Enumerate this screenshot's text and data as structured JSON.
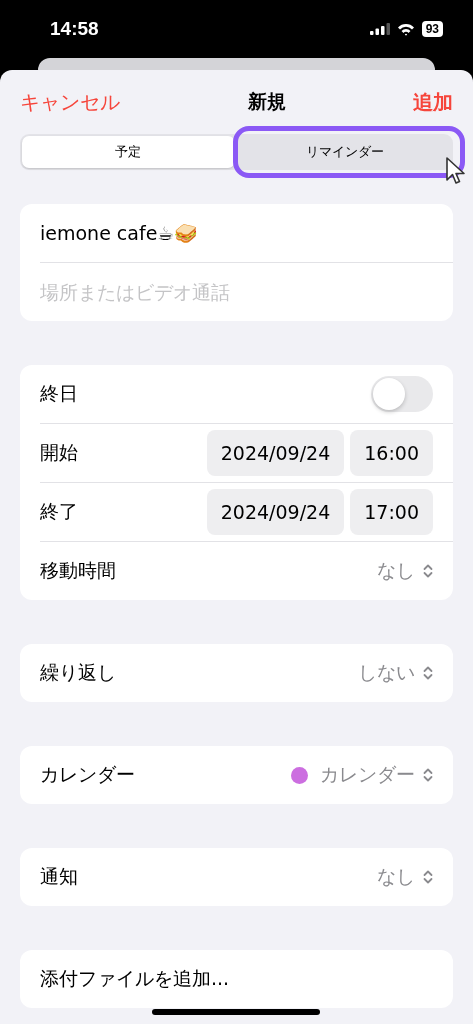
{
  "status_bar": {
    "time": "14:58",
    "battery": "93"
  },
  "nav": {
    "cancel": "キャンセル",
    "title": "新規",
    "add": "追加"
  },
  "segments": [
    {
      "label": "予定",
      "selected": true,
      "highlighted": false
    },
    {
      "label": "リマインダー",
      "selected": false,
      "highlighted": true
    }
  ],
  "event": {
    "title": "iemone cafe☕🥪",
    "location_placeholder": "場所またはビデオ通話"
  },
  "sections": [
    {
      "rows": [
        {
          "kind": "toggle",
          "label": "終日",
          "on": false
        },
        {
          "kind": "datetime",
          "label": "開始",
          "date": "2024/09/24",
          "time": "16:00"
        },
        {
          "kind": "datetime",
          "label": "終了",
          "date": "2024/09/24",
          "time": "17:00"
        },
        {
          "kind": "picker",
          "label": "移動時間",
          "value": "なし"
        }
      ]
    },
    {
      "rows": [
        {
          "kind": "picker",
          "label": "繰り返し",
          "value": "しない"
        }
      ]
    },
    {
      "rows": [
        {
          "kind": "picker",
          "label": "カレンダー",
          "value": "カレンダー",
          "color": "#cc6ee0"
        }
      ]
    },
    {
      "rows": [
        {
          "kind": "picker",
          "label": "通知",
          "value": "なし"
        }
      ]
    },
    {
      "rows": [
        {
          "kind": "action",
          "label": "添付ファイルを追加..."
        }
      ]
    }
  ]
}
